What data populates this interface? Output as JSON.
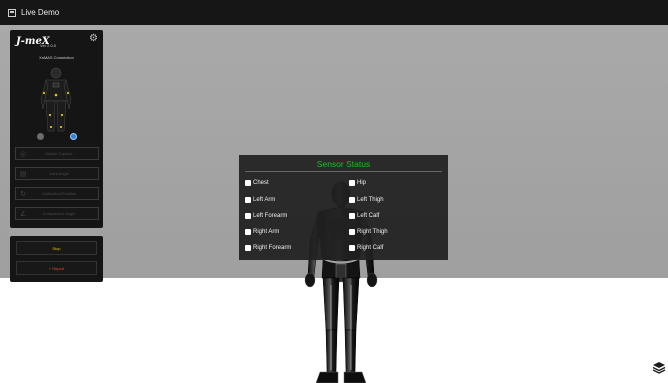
{
  "window": {
    "title": "Live Demo"
  },
  "sidebar": {
    "logo": "J-meX",
    "version": "Ver 2.0.0",
    "connection_label": "XsMAS  Connection",
    "buttons": [
      {
        "label": "Motion Capture",
        "icon": "target-icon"
      },
      {
        "label": "Joint Angle",
        "icon": "document-icon"
      },
      {
        "label": "Calibration/Position",
        "icon": "refresh-icon"
      },
      {
        "label": "Comparison Angle",
        "icon": "angle-icon"
      }
    ]
  },
  "controls": {
    "stop_label": "Stop",
    "report_label": "+ Report"
  },
  "sensor_dialog": {
    "title": "Sensor Status",
    "left_column": [
      "Chest",
      "Left Arm",
      "Left Forearm",
      "Right Arm",
      "Right Forearm"
    ],
    "right_column": [
      "Hip",
      "Left Thigh",
      "Left Calf",
      "Right Thigh",
      "Right Calf"
    ]
  },
  "colors": {
    "title_green": "#1fbf1f",
    "stop_yellow": "#e4c214",
    "report_red": "#e04a3a",
    "status_blue": "#2f83d9"
  }
}
